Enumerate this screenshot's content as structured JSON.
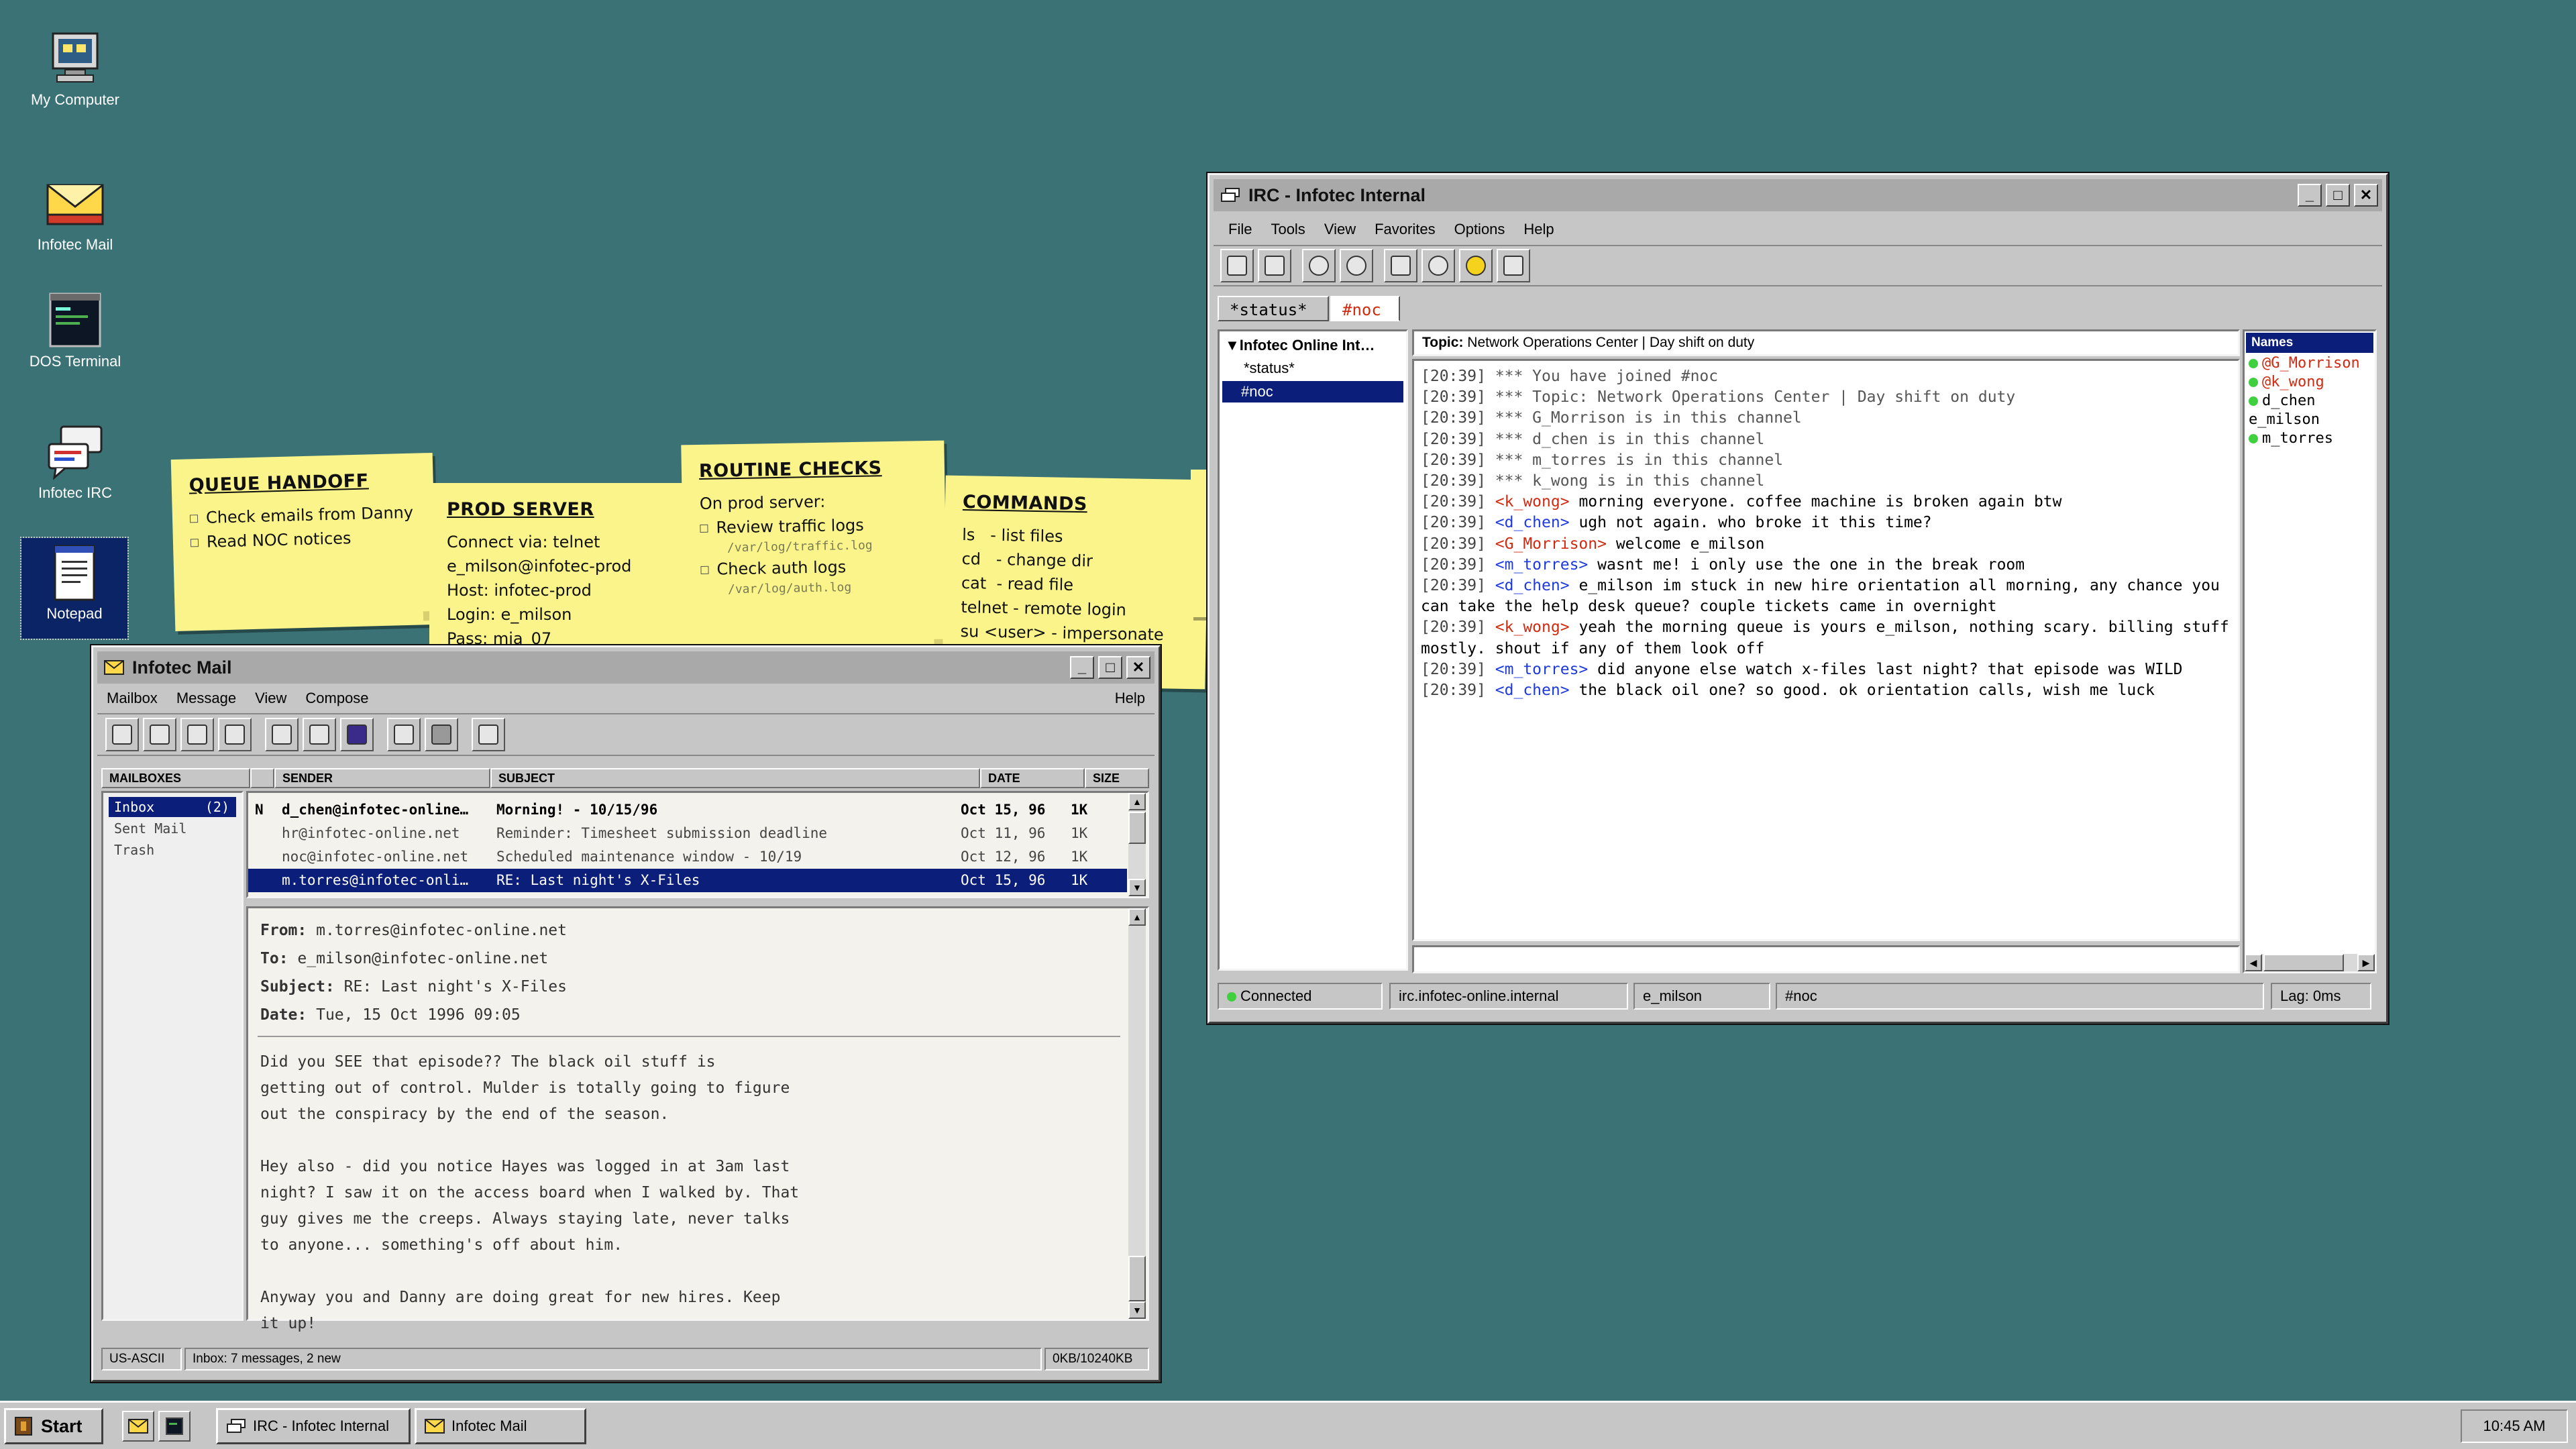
{
  "desktop": {
    "icons": [
      {
        "label": "My Computer",
        "icon": "computer-icon"
      },
      {
        "label": "Infotec Mail",
        "icon": "mail-envelope-icon"
      },
      {
        "label": "DOS Terminal",
        "icon": "terminal-icon"
      },
      {
        "label": "Infotec IRC",
        "icon": "chat-bubbles-icon"
      },
      {
        "label": "Notepad",
        "icon": "notepad-icon"
      }
    ],
    "stickies": [
      {
        "title": "QUEUE HANDOFF",
        "lines": [
          "Check emails from Danny",
          "Read NOC notices"
        ]
      },
      {
        "title": "PROD SERVER",
        "lines": [
          "Connect via: telnet",
          "e_milson@infotec-prod",
          "Host: infotec-prod",
          "Login: e_milson",
          "Pass: mia_07"
        ]
      },
      {
        "title": "ROUTINE CHECKS",
        "intro": "On prod server:",
        "items": [
          {
            "label": "Review traffic logs",
            "path": "/var/log/traffic.log"
          },
          {
            "label": "Check auth logs",
            "path": "/var/log/auth.log"
          }
        ]
      },
      {
        "title": "COMMANDS",
        "lines": [
          "ls   - list files",
          "cd   - change dir",
          "cat  - read file",
          "telnet - remote login",
          "su <user> - impersonate"
        ]
      }
    ]
  },
  "mail": {
    "title": "Infotec Mail",
    "menu": [
      "Mailbox",
      "Message",
      "View",
      "Compose"
    ],
    "help": "Help",
    "toolbar_icons": [
      "get-mail-icon",
      "reply-icon",
      "reply-all-icon",
      "forward-icon",
      "compose-icon",
      "attach-icon",
      "address-book-icon",
      "print-icon",
      "delete-icon",
      "edit-icon"
    ],
    "columns": {
      "mailboxes": "MAILBOXES",
      "sender": "SENDER",
      "subject": "SUBJECT",
      "date": "DATE",
      "size": "SIZE"
    },
    "folders": [
      {
        "name": "Inbox",
        "count": "(2)"
      },
      {
        "name": "Sent Mail",
        "count": ""
      },
      {
        "name": "Trash",
        "count": ""
      }
    ],
    "messages": [
      {
        "flag": "N",
        "sender": "d_chen@infotec-online…",
        "subject": "Morning! - 10/15/96",
        "date": "Oct 15, 96",
        "size": "1K"
      },
      {
        "flag": "",
        "sender": "hr@infotec-online.net",
        "subject": "Reminder: Timesheet submission deadline",
        "date": "Oct 11, 96",
        "size": "1K"
      },
      {
        "flag": "",
        "sender": "noc@infotec-online.net",
        "subject": "Scheduled maintenance window - 10/19",
        "date": "Oct 12, 96",
        "size": "1K"
      },
      {
        "flag": "",
        "sender": "m.torres@infotec-onli…",
        "subject": "RE: Last night's X-Files",
        "date": "Oct 15, 96",
        "size": "1K"
      }
    ],
    "preview": {
      "from_label": "From:",
      "from": "m.torres@infotec-online.net",
      "to_label": "To:",
      "to": "e_milson@infotec-online.net",
      "subject_label": "Subject:",
      "subject": "RE: Last night's X-Files",
      "date_label": "Date:",
      "date": "Tue, 15 Oct 1996 09:05",
      "body": "Did you SEE that episode?? The black oil stuff is\ngetting out of control. Mulder is totally going to figure\nout the conspiracy by the end of the season.\n\nHey also - did you notice Hayes was logged in at 3am last\nnight? I saw it on the access board when I walked by. That\nguy gives me the creeps. Always staying late, never talks\nto anyone... something's off about him.\n\nAnyway you and Danny are doing great for new hires. Keep\nit up!"
    },
    "status": {
      "encoding": "US-ASCII",
      "info": "Inbox: 7 messages, 2 new",
      "size": "0KB/10240KB"
    }
  },
  "irc": {
    "title": "IRC - Infotec Internal",
    "menu": [
      "File",
      "Tools",
      "View",
      "Favorites",
      "Options",
      "Help"
    ],
    "toolbar_icons": [
      "connect-icon",
      "disconnect-icon",
      "globe-icon",
      "globe-icon",
      "channel-list-icon",
      "globe-icon",
      "user-icon",
      "list-icon"
    ],
    "tabs": [
      "*status*",
      "#noc"
    ],
    "tree": {
      "root": "Infotec Online Int…",
      "children": [
        "*status*",
        "#noc"
      ]
    },
    "topic_label": "Topic:",
    "topic": "Network Operations Center | Day shift on duty",
    "lines": [
      {
        "ts": "[20:39]",
        "nick": "",
        "op": false,
        "text": "*** You have joined #noc"
      },
      {
        "ts": "[20:39]",
        "nick": "",
        "op": false,
        "text": "*** Topic: Network Operations Center | Day shift on duty"
      },
      {
        "ts": "[20:39]",
        "nick": "",
        "op": false,
        "text": "*** G_Morrison is in this channel"
      },
      {
        "ts": "[20:39]",
        "nick": "",
        "op": false,
        "text": "*** d_chen is in this channel"
      },
      {
        "ts": "[20:39]",
        "nick": "",
        "op": false,
        "text": "*** m_torres is in this channel"
      },
      {
        "ts": "[20:39]",
        "nick": "",
        "op": false,
        "text": "*** k_wong is in this channel"
      },
      {
        "ts": "[20:39]",
        "nick": "<k_wong>",
        "op": true,
        "text": "morning everyone. coffee machine is broken again btw"
      },
      {
        "ts": "[20:39]",
        "nick": "<d_chen>",
        "op": false,
        "text": "ugh not again. who broke it this time?"
      },
      {
        "ts": "[20:39]",
        "nick": "<G_Morrison>",
        "op": true,
        "text": "welcome e_milson"
      },
      {
        "ts": "[20:39]",
        "nick": "<m_torres>",
        "op": false,
        "text": "wasnt me! i only use the one in the break room"
      },
      {
        "ts": "[20:39]",
        "nick": "<d_chen>",
        "op": false,
        "text": "e_milson im stuck in new hire orientation all morning, any chance you can take the help desk queue? couple tickets came in overnight"
      },
      {
        "ts": "[20:39]",
        "nick": "<k_wong>",
        "op": true,
        "text": "yeah the morning queue is yours e_milson, nothing scary. billing stuff mostly. shout if any of them look off"
      },
      {
        "ts": "[20:39]",
        "nick": "<m_torres>",
        "op": false,
        "text": "did anyone else watch x-files last night? that episode was WILD"
      },
      {
        "ts": "[20:39]",
        "nick": "<d_chen>",
        "op": false,
        "text": "the black oil one? so good. ok orientation calls, wish me luck"
      }
    ],
    "names_header": "Names",
    "names": [
      {
        "prefix": "@",
        "name": "G_Morrison",
        "op": true,
        "online": true
      },
      {
        "prefix": "@",
        "name": "k_wong",
        "op": true,
        "online": true
      },
      {
        "prefix": "",
        "name": "d_chen",
        "op": false,
        "online": true
      },
      {
        "prefix": "",
        "name": "e_milson",
        "op": false,
        "online": false
      },
      {
        "prefix": "",
        "name": "m_torres",
        "op": false,
        "online": true
      }
    ],
    "status": {
      "state": "Connected",
      "server": "irc.infotec-online.internal",
      "nick": "e_milson",
      "channel": "#noc",
      "lag": "Lag: 0ms"
    }
  },
  "taskbar": {
    "start": "Start",
    "tasks": [
      {
        "label": "IRC - Infotec Internal",
        "icon": "chat-bubbles-icon"
      },
      {
        "label": "Infotec Mail",
        "icon": "mail-envelope-icon"
      }
    ],
    "clock": "10:45 AM"
  }
}
